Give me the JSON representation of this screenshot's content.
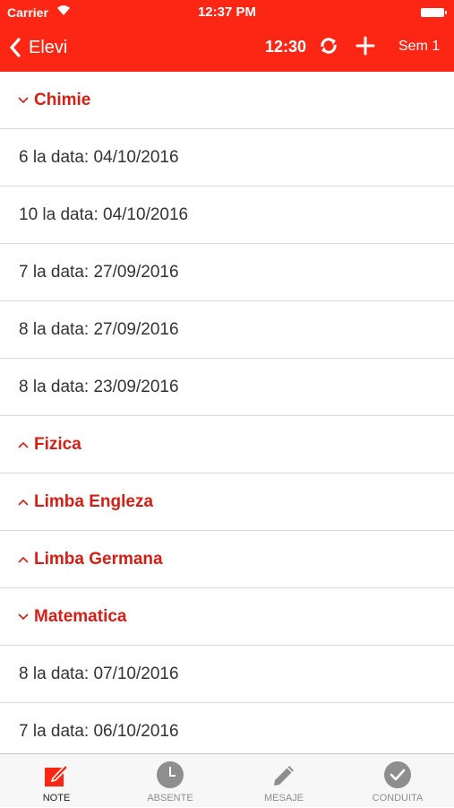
{
  "status_bar": {
    "carrier": "Carrier",
    "time": "12:37 PM"
  },
  "nav": {
    "back_label": "Elevi",
    "time": "12:30",
    "semester": "Sem 1"
  },
  "list": {
    "rows": [
      {
        "type": "section",
        "label": "Chimie",
        "expanded": true
      },
      {
        "type": "grade",
        "text": "6 la data: 04/10/2016"
      },
      {
        "type": "grade",
        "text": "10 la data: 04/10/2016"
      },
      {
        "type": "grade",
        "text": "7 la data: 27/09/2016"
      },
      {
        "type": "grade",
        "text": "8 la data: 27/09/2016"
      },
      {
        "type": "grade",
        "text": "8 la data: 23/09/2016"
      },
      {
        "type": "section",
        "label": "Fizica",
        "expanded": false
      },
      {
        "type": "section",
        "label": "Limba Engleza",
        "expanded": false
      },
      {
        "type": "section",
        "label": "Limba Germana",
        "expanded": false
      },
      {
        "type": "section",
        "label": "Matematica",
        "expanded": true
      },
      {
        "type": "grade",
        "text": "8 la data: 07/10/2016"
      },
      {
        "type": "grade",
        "text": "7 la data: 06/10/2016"
      }
    ]
  },
  "tabs": [
    {
      "label": "NOTE",
      "icon": "edit-square-icon",
      "active": true
    },
    {
      "label": "ABSENTE",
      "icon": "clock-icon",
      "active": false
    },
    {
      "label": "MESAJE",
      "icon": "pencil-icon",
      "active": false
    },
    {
      "label": "CONDUITA",
      "icon": "checkmark-circle-icon",
      "active": false
    }
  ],
  "colors": {
    "accent": "#fb2614",
    "section_text": "#d81e14",
    "tab_active": "#fb2614",
    "tab_inactive": "#8e8e8e"
  }
}
